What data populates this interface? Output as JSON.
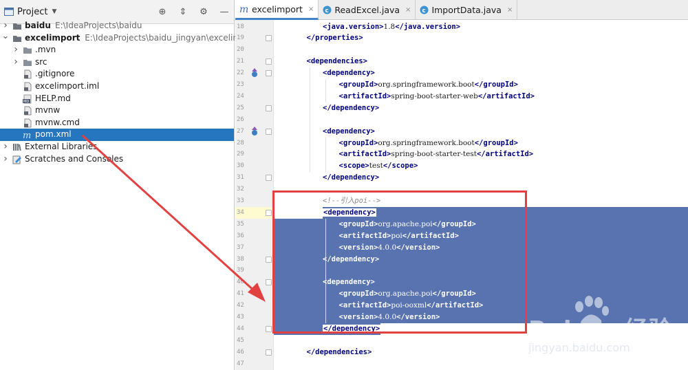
{
  "project_panel": {
    "title": "Project",
    "tree": [
      {
        "label": "baidu",
        "path": "E:\\IdeaProjects\\baidu",
        "bold": true,
        "type": "folder",
        "expanded": false
      },
      {
        "label": "excelimport",
        "path": "E:\\IdeaProjects\\baidu_jingyan\\excelimport",
        "bold": true,
        "type": "folder",
        "expanded": true
      },
      {
        "label": ".mvn",
        "type": "folder"
      },
      {
        "label": "src",
        "type": "folder"
      },
      {
        "label": ".gitignore",
        "type": "file"
      },
      {
        "label": "excelimport.iml",
        "type": "file"
      },
      {
        "label": "HELP.md",
        "type": "md"
      },
      {
        "label": "mvnw",
        "type": "file"
      },
      {
        "label": "mvnw.cmd",
        "type": "file"
      },
      {
        "label": "pom.xml",
        "type": "maven",
        "selected": true
      },
      {
        "label": "External Libraries",
        "type": "library"
      },
      {
        "label": "Scratches and Consoles",
        "type": "scratch"
      }
    ]
  },
  "tabs": [
    {
      "label": "excelimport",
      "icon": "maven-icon",
      "active": true
    },
    {
      "label": "ReadExcel.java",
      "icon": "class-icon",
      "active": false
    },
    {
      "label": "ImportData.java",
      "icon": "class-icon",
      "active": false
    }
  ],
  "editor": {
    "lines": [
      {
        "n": "18",
        "parts": [
          [
            "tag",
            "<java.version>"
          ],
          [
            "val",
            "1.8"
          ],
          [
            "tag",
            "</java.version>"
          ]
        ]
      },
      {
        "n": "19",
        "parts": [
          [
            "tag",
            "</properties>"
          ]
        ]
      },
      {
        "n": "20",
        "parts": []
      },
      {
        "n": "21",
        "parts": [
          [
            "tag",
            "<dependencies>"
          ]
        ]
      },
      {
        "n": "22",
        "parts": [
          [
            "tag",
            "<dependency>"
          ]
        ]
      },
      {
        "n": "23",
        "parts": [
          [
            "tag",
            "<groupId>"
          ],
          [
            "val",
            "org.springframework.boot"
          ],
          [
            "tag",
            "</groupId>"
          ]
        ]
      },
      {
        "n": "24",
        "parts": [
          [
            "tag",
            "<artifactId>"
          ],
          [
            "val",
            "spring-boot-starter-web"
          ],
          [
            "tag",
            "</artifactId>"
          ]
        ]
      },
      {
        "n": "25",
        "parts": [
          [
            "tag",
            "</dependency>"
          ]
        ]
      },
      {
        "n": "26",
        "parts": []
      },
      {
        "n": "27",
        "parts": [
          [
            "tag",
            "<dependency>"
          ]
        ]
      },
      {
        "n": "28",
        "parts": [
          [
            "tag",
            "<groupId>"
          ],
          [
            "val",
            "org.springframework.boot"
          ],
          [
            "tag",
            "</groupId>"
          ]
        ]
      },
      {
        "n": "29",
        "parts": [
          [
            "tag",
            "<artifactId>"
          ],
          [
            "val",
            "spring-boot-starter-test"
          ],
          [
            "tag",
            "</artifactId>"
          ]
        ]
      },
      {
        "n": "30",
        "parts": [
          [
            "tag",
            "<scope>"
          ],
          [
            "val",
            "test"
          ],
          [
            "tag",
            "</scope>"
          ]
        ]
      },
      {
        "n": "31",
        "parts": [
          [
            "tag",
            "</dependency>"
          ]
        ]
      },
      {
        "n": "32",
        "parts": []
      },
      {
        "n": "33",
        "parts": [
          [
            "comment",
            "<!--引入poi-->"
          ]
        ]
      },
      {
        "n": "34",
        "parts": [
          [
            "tag",
            "<dependency>"
          ]
        ]
      },
      {
        "n": "35",
        "parts": [
          [
            "tag",
            "<groupId>"
          ],
          [
            "val",
            "org.apache.poi"
          ],
          [
            "tag",
            "</groupId>"
          ]
        ]
      },
      {
        "n": "36",
        "parts": [
          [
            "tag",
            "<artifactId>"
          ],
          [
            "val",
            "poi"
          ],
          [
            "tag",
            "</artifactId>"
          ]
        ]
      },
      {
        "n": "37",
        "parts": [
          [
            "tag",
            "<version>"
          ],
          [
            "val",
            "4.0.0"
          ],
          [
            "tag",
            "</version>"
          ]
        ]
      },
      {
        "n": "38",
        "parts": [
          [
            "tag",
            "</dependency>"
          ]
        ]
      },
      {
        "n": "39",
        "parts": []
      },
      {
        "n": "40",
        "parts": [
          [
            "tag",
            "<dependency>"
          ]
        ]
      },
      {
        "n": "41",
        "parts": [
          [
            "tag",
            "<groupId>"
          ],
          [
            "val",
            "org.apache.poi"
          ],
          [
            "tag",
            "</groupId>"
          ]
        ]
      },
      {
        "n": "42",
        "parts": [
          [
            "tag",
            "<artifactId>"
          ],
          [
            "val",
            "poi-ooxml"
          ],
          [
            "tag",
            "</artifactId>"
          ]
        ]
      },
      {
        "n": "43",
        "parts": [
          [
            "tag",
            "<version>"
          ],
          [
            "val",
            "4.0.0"
          ],
          [
            "tag",
            "</version>"
          ]
        ]
      },
      {
        "n": "44",
        "parts": [
          [
            "tag",
            "</dependency>"
          ]
        ]
      },
      {
        "n": "45",
        "parts": []
      },
      {
        "n": "46",
        "parts": [
          [
            "tag",
            "</dependencies>"
          ]
        ]
      },
      {
        "n": "47",
        "parts": []
      }
    ]
  },
  "watermark": {
    "main": "Bai du 经验",
    "sub": "jingyan.baidu.com"
  },
  "colors": {
    "selection": "#5873b0",
    "tree_selected": "#2675bf",
    "xml_tag": "#00007f",
    "annotation": "#e24141"
  }
}
